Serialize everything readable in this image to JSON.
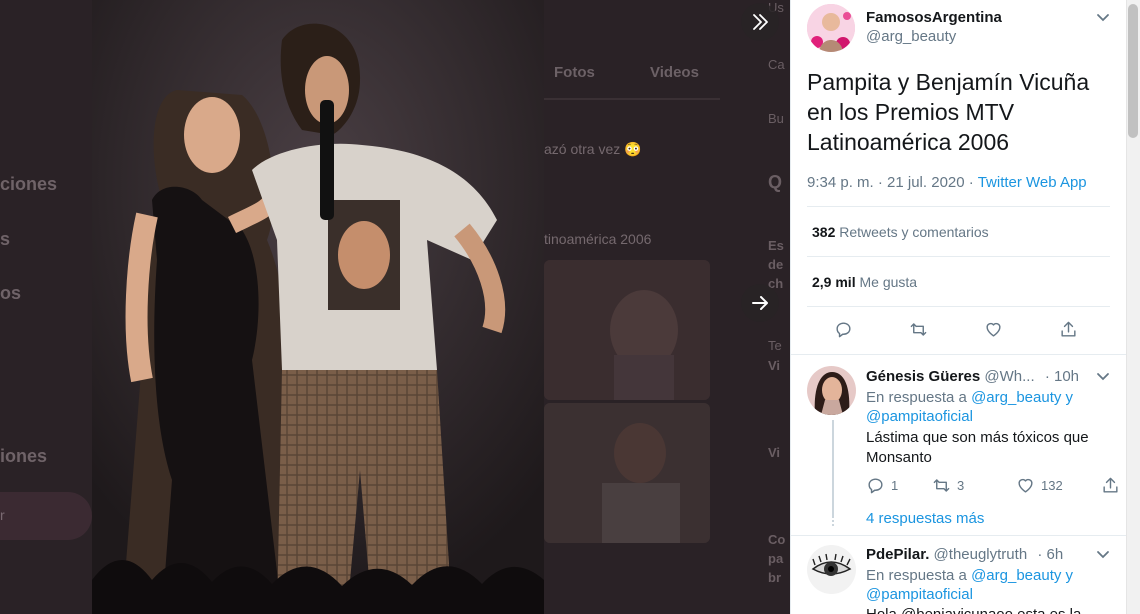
{
  "background": {
    "nav_items": [
      "ciones",
      "s",
      "os",
      "iones"
    ],
    "pill_label": "r",
    "tabs": [
      "Fotos",
      "Videos"
    ],
    "snippets": [
      "azó otra vez 😳",
      "tinoamérica 2006"
    ],
    "right_col": [
      "Us",
      "Ca",
      "Bu",
      "Q",
      "Es",
      "de",
      "ch",
      "Te",
      "Vi",
      "Vi",
      "Co",
      "pa",
      "br"
    ]
  },
  "tweet": {
    "author_name": "FamososArgentina",
    "author_handle": "@arg_beauty",
    "text": "Pampita y Benjamín Vicuña en los Premios MTV Latinoamérica 2006",
    "time": "9:34 p. m. · 21 jul. 2020",
    "sep": "·",
    "client": "Twitter Web App",
    "retweets_count": "382",
    "retweets_label": "Retweets y comentarios",
    "likes_count": "2,9 mil",
    "likes_label": "Me gusta"
  },
  "replies": [
    {
      "name": "Génesis Güeres",
      "handle": "@Wh...",
      "time": "· 10h",
      "reply_prefix": "En respuesta a",
      "reply_to_1": "@arg_beauty",
      "reply_and": "y",
      "reply_to_2": "@pampitaoficial",
      "text": "Lástima que son más tóxicos que Monsanto",
      "replies_count": "1",
      "retweets_count": "3",
      "likes_count": "132",
      "more_label": "4 respuestas más"
    },
    {
      "name": "PdePilar.",
      "handle": "@theuglytruth",
      "time": "· 6h",
      "reply_prefix": "En respuesta a",
      "reply_to_1": "@arg_beauty",
      "reply_and": "y",
      "reply_to_2": "@pampitaoficial",
      "text_partial": "Hola @benjavicunaoo esta es la"
    }
  ],
  "icons": {
    "expand": "chevron-double-right-icon",
    "next": "arrow-right-icon",
    "caret": "chevron-down-icon",
    "reply": "reply-icon",
    "retweet": "retweet-icon",
    "like": "heart-icon",
    "share": "share-icon"
  },
  "colors": {
    "link": "#1b95e0",
    "text": "#14171a",
    "muted": "#657786"
  }
}
